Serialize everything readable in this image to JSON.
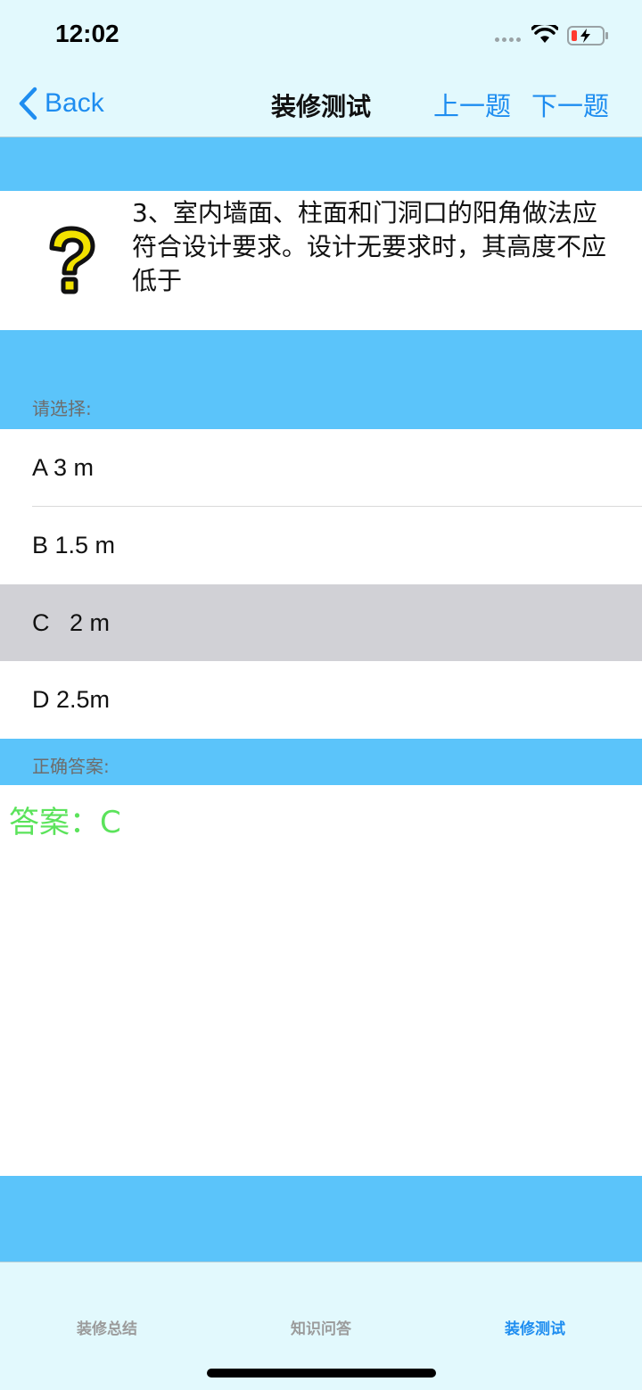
{
  "status_bar": {
    "time": "12:02"
  },
  "nav": {
    "back_label": "Back",
    "title": "装修测试",
    "prev_label": "上一题",
    "next_label": "下一题"
  },
  "question": {
    "text": "3、室内墙面、柱面和门洞口的阳角做法应符合设计要求。设计无要求时，其高度不应低于"
  },
  "choose_label": "请选择:",
  "options": [
    {
      "label": "A 3 m",
      "selected": false
    },
    {
      "label": "B 1.5 m",
      "selected": false
    },
    {
      "label": "C   2 m",
      "selected": true
    },
    {
      "label": "D 2.5m",
      "selected": false
    }
  ],
  "correct_label": "正确答案:",
  "answer": "答案：C",
  "tabs": [
    {
      "label": "装修总结",
      "active": false
    },
    {
      "label": "知识问答",
      "active": false
    },
    {
      "label": "装修测试",
      "active": true
    }
  ],
  "colors": {
    "accent": "#1e8df0",
    "band": "#5bc4fa",
    "answer": "#5be35b",
    "selected_row": "#d1d1d6"
  }
}
